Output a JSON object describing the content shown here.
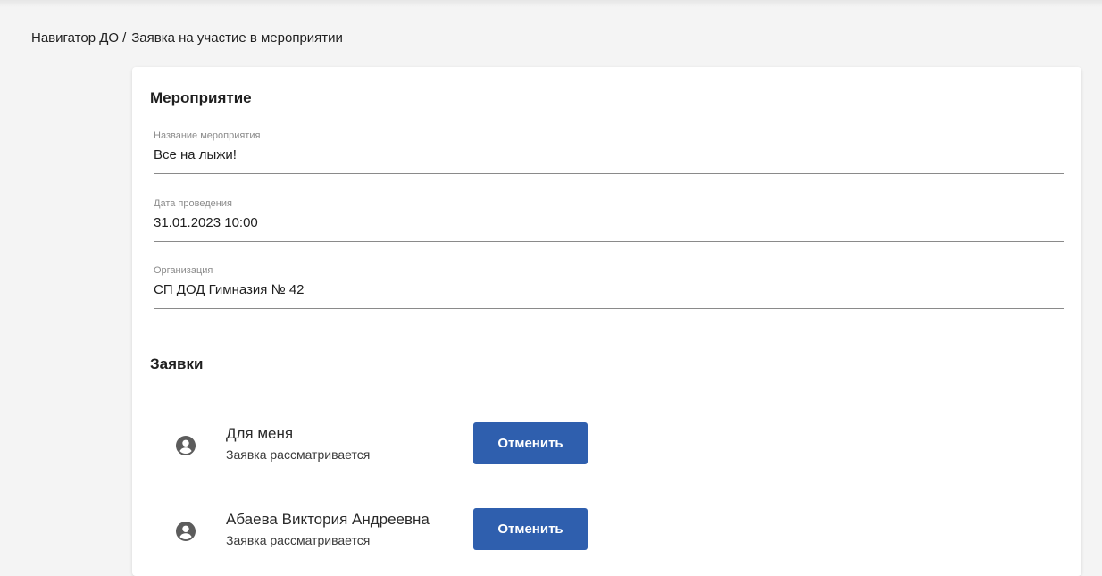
{
  "breadcrumb": {
    "root": "Навигатор ДО",
    "separator": "/",
    "current": "Заявка на участие в мероприятии"
  },
  "event_section": {
    "title": "Мероприятие",
    "fields": [
      {
        "label": "Название мероприятия",
        "value": "Все на лыжи!"
      },
      {
        "label": "Дата проведения",
        "value": "31.01.2023 10:00"
      },
      {
        "label": "Организация",
        "value": "СП ДОД Гимназия № 42"
      }
    ]
  },
  "requests_section": {
    "title": "Заявки",
    "items": [
      {
        "name": "Для меня",
        "status": "Заявка рассматривается",
        "action_label": "Отменить",
        "icon": "account-circle-icon"
      },
      {
        "name": "Абаева Виктория Андреевна",
        "status": "Заявка рассматривается",
        "action_label": "Отменить",
        "icon": "account-circle-icon"
      }
    ]
  },
  "colors": {
    "primary_button": "#2f5fae",
    "background": "#f4f4f4"
  }
}
